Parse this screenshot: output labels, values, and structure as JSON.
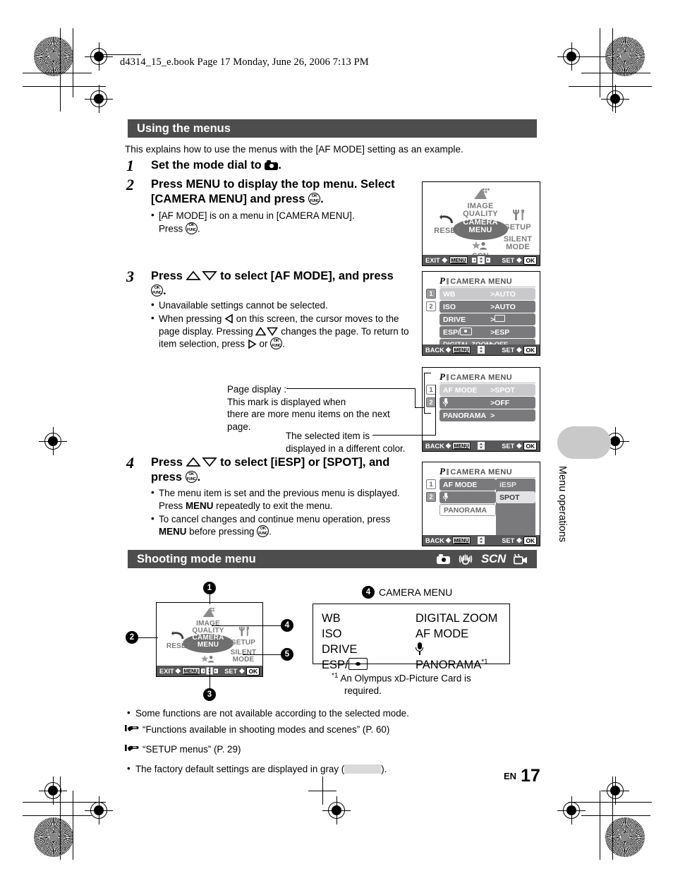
{
  "header": {
    "book_line": "d4314_15_e.book  Page 17  Monday, June 26, 2006  7:13 PM"
  },
  "sections": {
    "using_menus": {
      "title": "Using the menus",
      "intro": "This explains how to use the menus with the [AF MODE] setting as an example."
    },
    "shooting_mode": {
      "title": "Shooting mode menu",
      "mode_icons": [
        "camera-icon",
        "image-stabilization-icon",
        "SCN",
        "movie-icon"
      ],
      "scn_label": "SCN"
    }
  },
  "steps": [
    {
      "num": "1",
      "text_before": "Set the mode dial to ",
      "text_after": ".",
      "icon": "camera-icon",
      "bullets": []
    },
    {
      "num": "2",
      "line1": "Press MENU to display the top menu. Select",
      "line2_before": "[CAMERA MENU] and press ",
      "line2_after": ".",
      "bullets": [
        {
          "line1": "[AF MODE] is on a menu in [CAMERA MENU].",
          "line2_before": "Press ",
          "line2_after": "."
        }
      ]
    },
    {
      "num": "3",
      "line1_before": "Press ",
      "line1_mid": " to select [AF MODE], and press",
      "line2_after": ".",
      "bullets": [
        {
          "text": "Unavailable settings cannot be selected."
        },
        {
          "p1": "When pressing ",
          "p2": " on this screen, the cursor moves to the",
          "p3": "page display. Pressing ",
          "p4": " changes the page. To return",
          "p5": "to item selection, press ",
          "p6": " or ",
          "p7": "."
        }
      ]
    },
    {
      "num": "4",
      "line1_before": "Press ",
      "line1_mid": " to select [iESP] or [SPOT], and",
      "line2_before": "press ",
      "line2_after": ".",
      "bullets": [
        {
          "l1": "The menu item is set and the previous menu is displayed.",
          "l2a": "Press ",
          "l2b": "MENU",
          "l2c": " repeatedly to exit the menu."
        },
        {
          "l1": "To cancel changes and continue menu operation, press",
          "l2a": "MENU",
          "l2b": " before pressing ",
          "l2c": "."
        }
      ]
    }
  ],
  "screens": {
    "top_menu": {
      "items": [
        {
          "label1": "IMAGE",
          "label2": "QUALITY",
          "selected": false
        },
        {
          "label1": "RESET",
          "label2": "",
          "selected": false
        },
        {
          "label1": "CAMERA",
          "label2": "MENU",
          "selected": true
        },
        {
          "label1": "SETUP",
          "label2": "",
          "selected": false
        },
        {
          "label1": "SCN",
          "label2": "",
          "selected": false
        },
        {
          "label1": "SILENT",
          "label2": "MODE",
          "selected": false
        }
      ],
      "bar": {
        "left": "EXIT",
        "left_key": "MENU",
        "right": "SET",
        "right_key": "OK"
      }
    },
    "camera_menu_p1": {
      "mode": "P",
      "title": "CAMERA MENU",
      "pages": [
        "1",
        "2"
      ],
      "active_page": "1",
      "rows": [
        {
          "name": "WB",
          "value": "AUTO",
          "selected": true,
          "type": "text"
        },
        {
          "name": "ISO",
          "value": "AUTO",
          "selected": false,
          "type": "text"
        },
        {
          "name": "DRIVE",
          "value": "",
          "selected": false,
          "type": "box"
        },
        {
          "name": "ESP/",
          "value": "ESP",
          "selected": false,
          "type": "esp"
        },
        {
          "name": "DIGITAL ZOOM",
          "value": "OFF",
          "selected": false,
          "type": "text"
        }
      ],
      "bar": {
        "left": "BACK",
        "left_key": "MENU",
        "right": "SET",
        "right_key": "OK"
      }
    },
    "camera_menu_p2": {
      "mode": "P",
      "title": "CAMERA MENU",
      "pages": [
        "1",
        "2"
      ],
      "active_page": "2",
      "rows": [
        {
          "name": "AF MODE",
          "value": "SPOT",
          "selected": true,
          "type": "text"
        },
        {
          "name": "",
          "value": "OFF",
          "selected": false,
          "type": "mic"
        },
        {
          "name": "PANORAMA",
          "value": "",
          "selected": false,
          "type": "text"
        }
      ],
      "bar": {
        "left": "BACK",
        "left_key": "MENU",
        "right": "SET",
        "right_key": "OK"
      }
    },
    "camera_menu_p2_sub": {
      "mode": "P",
      "title": "CAMERA MENU",
      "pages": [
        "1",
        "2"
      ],
      "active_page": "2",
      "rows": [
        {
          "name": "AF MODE",
          "value": "",
          "selected": false,
          "type": "text"
        },
        {
          "name": "",
          "value": "",
          "selected": false,
          "type": "mic"
        },
        {
          "name": "PANORAMA",
          "value": "",
          "selected": false,
          "type": "text"
        }
      ],
      "submenu": [
        {
          "label": "iESP",
          "highlighted": false
        },
        {
          "label": "SPOT",
          "highlighted": true
        }
      ],
      "bar": {
        "left": "BACK",
        "left_key": "MENU",
        "right": "SET",
        "right_key": "OK"
      }
    }
  },
  "annotations": {
    "page_display": {
      "l1": "Page display :",
      "l2": "This mark is displayed when",
      "l3": "there are more menu items on the next",
      "l4": "page."
    },
    "selected_item": {
      "l1": "The selected item is",
      "l2": "displayed in a different color."
    }
  },
  "diagram": {
    "callouts": [
      "1",
      "2",
      "3",
      "4",
      "5"
    ],
    "menu_screen": {
      "items": [
        {
          "label1": "IMAGE",
          "label2": "QUALITY"
        },
        {
          "label1": "RESET",
          "label2": ""
        },
        {
          "label1": "CAMERA",
          "label2": "MENU"
        },
        {
          "label1": "SETUP",
          "label2": ""
        },
        {
          "label1": "SCN",
          "label2": ""
        },
        {
          "label1": "SILENT",
          "label2": "MODE"
        }
      ],
      "bar": {
        "left": "EXIT",
        "left_key": "MENU",
        "right": "SET",
        "right_key": "OK"
      }
    },
    "table": {
      "bubble": "4",
      "title": "CAMERA MENU",
      "col1": [
        "WB",
        "ISO",
        "DRIVE",
        "ESP/"
      ],
      "col2": [
        "DIGITAL ZOOM",
        "AF MODE",
        "mic-icon",
        "PANORAMA"
      ],
      "panorama_sup": "*1"
    },
    "footnote": {
      "marker": "*1",
      "l1": "An Olympus xD-Picture Card is",
      "l2": "required."
    }
  },
  "footnotes": {
    "n1": "Some functions are not available according to the selected mode.",
    "n2": "“Functions available in shooting modes and scenes” (P. 60)",
    "n3": "“SETUP menus” (P. 29)",
    "n4a": "The factory default settings are displayed in gray (",
    "n4b": ")."
  },
  "side_tab": {
    "label": "Menu operations"
  },
  "page_footer": {
    "lang": "EN",
    "number": "17"
  }
}
